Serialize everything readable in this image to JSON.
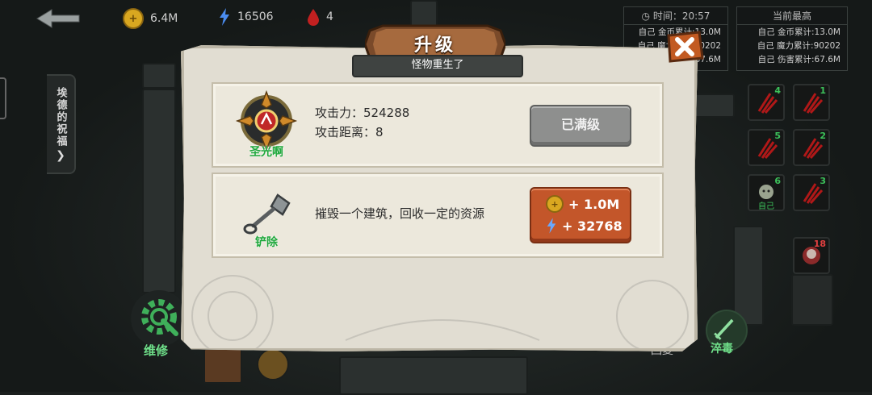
{
  "hud": {
    "gold": "6.4M",
    "mana": "16506",
    "lives": "4"
  },
  "side_tab": {
    "label": "埃德的祝福"
  },
  "stats_self": {
    "time_label": "时间：",
    "time_value": "20:57",
    "lines": [
      "自己 金币累计:13.0M",
      "自己 魔力累计:90202",
      "自己 伤害累计:67.6M"
    ]
  },
  "stats_best": {
    "title": "当前最高",
    "lines": [
      "自己 金币累计:13.0M",
      "自己 魔力累计:90202",
      "自己 伤害累计:67.6M"
    ]
  },
  "skills": [
    {
      "num": "4"
    },
    {
      "num": "1"
    },
    {
      "num": "5"
    },
    {
      "num": "2"
    },
    {
      "num": "6",
      "label": "自己"
    },
    {
      "num": "3"
    },
    {
      "num": "18"
    }
  ],
  "bottom": {
    "repair_label": "维修",
    "behind_label": "回复",
    "poison_label": "淬毒"
  },
  "modal": {
    "title": "升级",
    "subtitle": "怪物重生了",
    "upgrade": {
      "icon_label": "圣光啊",
      "attack_label": "攻击力：",
      "attack_value": "524288",
      "range_label": "攻击距离：",
      "range_value": "8",
      "button_label": "已满级"
    },
    "remove": {
      "icon_label": "铲除",
      "description": "摧毁一个建筑，回收一定的资源",
      "gold_reward": "+ 1.0M",
      "mana_reward": "+ 32768"
    }
  },
  "colors": {
    "gold": "#d9a720",
    "mana": "#4a8cf0",
    "green_label": "#1fa83c",
    "reward_button": "#c3562a",
    "disabled_button": "#8e8f8e"
  }
}
